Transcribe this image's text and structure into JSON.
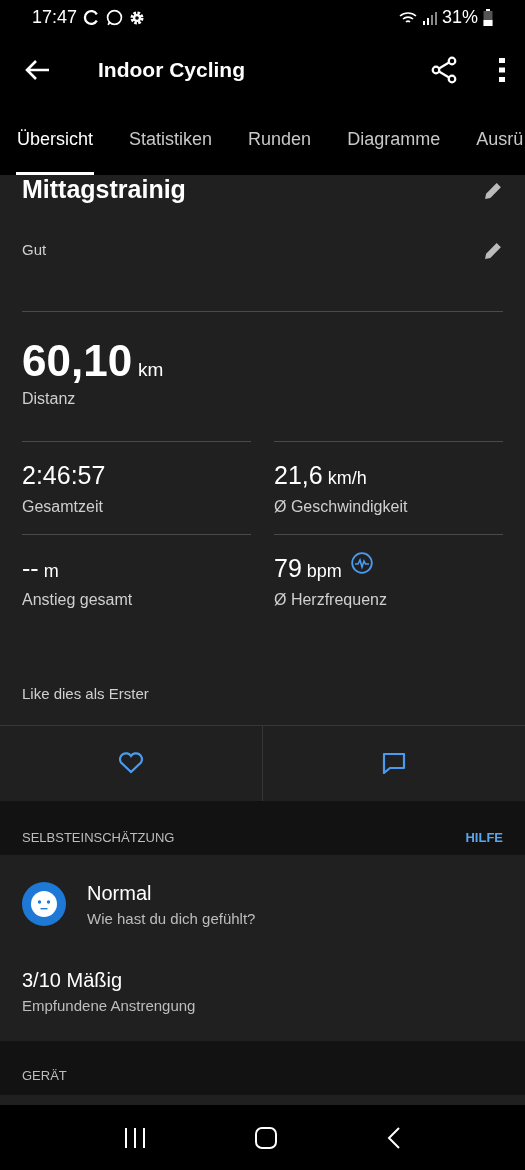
{
  "status_bar": {
    "time": "17:47",
    "battery": "31%"
  },
  "app_bar": {
    "title": "Indoor Cycling"
  },
  "tabs": [
    {
      "label": "Übersicht",
      "selected": true
    },
    {
      "label": "Statistiken",
      "selected": false
    },
    {
      "label": "Runden",
      "selected": false
    },
    {
      "label": "Diagramme",
      "selected": false
    },
    {
      "label": "Ausrü",
      "selected": false
    }
  ],
  "activity": {
    "name": "Mittagstrainig",
    "note": "Gut"
  },
  "distance": {
    "value": "60,10",
    "unit": "km",
    "label": "Distanz"
  },
  "metrics": [
    {
      "value": "2:46:57",
      "label": "Gesamtzeit"
    },
    {
      "value": "21,6",
      "unit": "km/h",
      "label": "Ø Geschwindigkeit"
    },
    {
      "value": "--",
      "unit": "m",
      "label": "Anstieg gesamt"
    },
    {
      "value": "79",
      "unit": "bpm",
      "label": "Ø Herzfrequenz",
      "heart_icon": true
    }
  ],
  "like_text": "Like dies als Erster",
  "self_evaluation": {
    "header": "SELBSTEINSCHÄTZUNG",
    "help": "HILFE",
    "feeling": "Normal",
    "feeling_prompt": "Wie hast du dich gefühlt?",
    "effort": "3/10 Mäßig",
    "effort_label": "Empfundene Anstrengung"
  },
  "device": {
    "header": "GERÄT"
  }
}
